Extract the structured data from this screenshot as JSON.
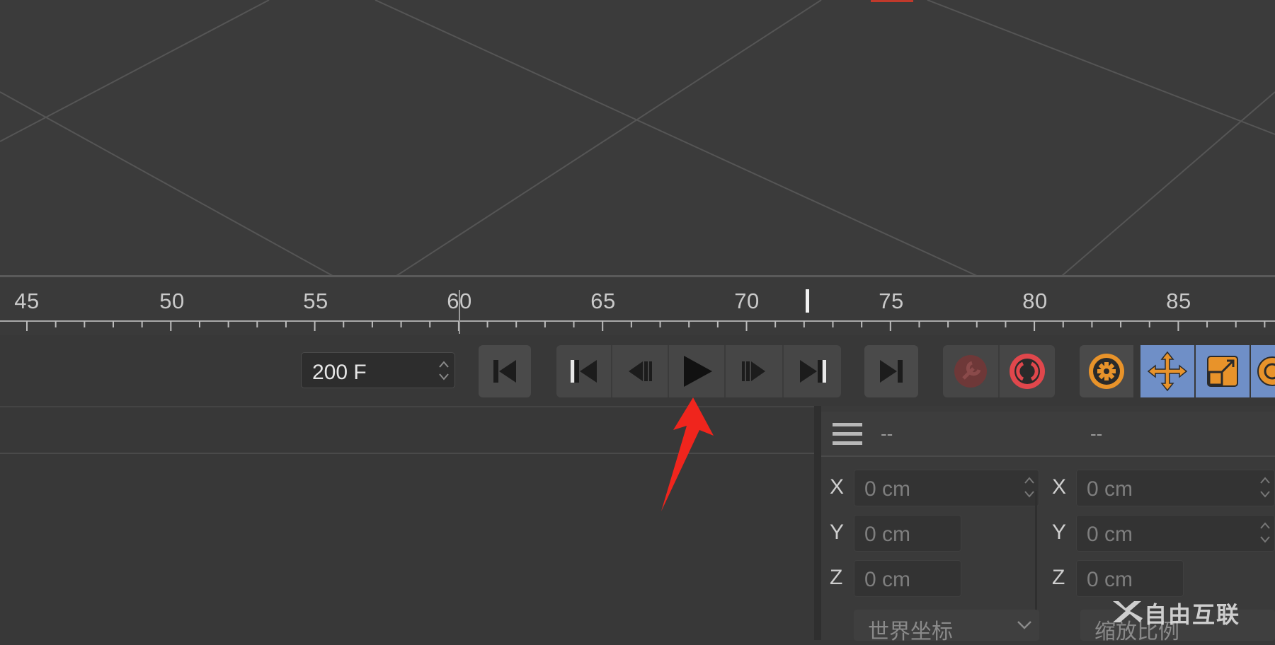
{
  "timeline": {
    "ruler_labels": [
      "45",
      "50",
      "55",
      "60",
      "65",
      "70",
      "75",
      "80",
      "85"
    ],
    "current_frame_marker": "73"
  },
  "transport": {
    "end_frame_value": "200 F",
    "buttons": {
      "go_to_start": "go-to-start-icon",
      "first_key": "first-key-icon",
      "prev_frame": "prev-frame-icon",
      "play": "play-icon",
      "next_frame": "next-frame-icon",
      "last_key": "last-key-icon",
      "go_to_end": "go-to-end-icon",
      "record": "record-key-icon",
      "autokey": "autokey-icon",
      "keyframe_settings": "gear-icon",
      "move_tool": "move-icon",
      "scale_tool": "scale-icon"
    }
  },
  "attributes": {
    "header_left": "--",
    "header_right": "--",
    "position": [
      {
        "axis": "X",
        "value": "0 cm"
      },
      {
        "axis": "Y",
        "value": "0 cm"
      },
      {
        "axis": "Z",
        "value": "0 cm"
      }
    ],
    "scale": [
      {
        "axis": "X",
        "value": "0 cm"
      },
      {
        "axis": "Y",
        "value": "0 cm"
      },
      {
        "axis": "Z",
        "value": "0 cm"
      }
    ],
    "coord_system": "世界坐标",
    "scale_mode": "缩放比例"
  },
  "watermark": "自由互联",
  "colors": {
    "viewport_bg": "#3b3b3b",
    "ui_bg": "#383838",
    "active_blue": "#6f8fc7",
    "accent_orange": "#e8932a",
    "record_red": "#e0474c",
    "annotation_arrow": "#f0251d"
  }
}
